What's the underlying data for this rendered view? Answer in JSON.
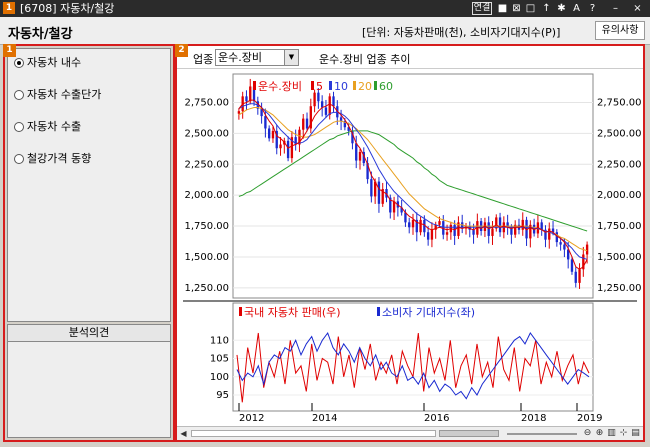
{
  "titlebar": {
    "badge": "1",
    "title": "[6708] 자동차/철강",
    "link_label": "연결",
    "icons": [
      "lock-icon",
      "close-box-icon",
      "restore-icon",
      "pin-icon",
      "settings-icon",
      "font-icon",
      "help-icon",
      "minimize-icon",
      "close-icon"
    ]
  },
  "header": {
    "title": "자동차/철강",
    "unit_text": "[단위: 자동차판매(천), 소비자기대지수(P)]",
    "notice_button": "유의사항"
  },
  "left_panel": {
    "badge": "1",
    "menu": [
      {
        "label": "자동차 내수",
        "selected": true
      },
      {
        "label": "자동차 수출단가",
        "selected": false
      },
      {
        "label": "자동차 수출",
        "selected": false
      },
      {
        "label": "철강가격 동향",
        "selected": false
      }
    ],
    "opinion_header": "분석의견"
  },
  "right_panel": {
    "badge": "2",
    "sector_label": "업종",
    "sector_value": "운수.장비",
    "chart_title": "운수.장비 업종 추이"
  },
  "chart_data": [
    {
      "type": "candlestick",
      "legend": [
        {
          "name": "운수.장비",
          "color": "#e00000"
        },
        {
          "name": "5",
          "color": "#e00000"
        },
        {
          "name": "10",
          "color": "#2a3ad8"
        },
        {
          "name": "20",
          "color": "#e8a020"
        },
        {
          "name": "60",
          "color": "#2e9e2e"
        }
      ],
      "ylim": [
        1200,
        2900
      ],
      "yticks": [
        1250,
        1500,
        1750,
        2000,
        2250,
        2500,
        2750
      ],
      "ytick_labels": [
        "1,250.00",
        "1,500.00",
        "1,750.00",
        "2,000.00",
        "2,250.00",
        "2,500.00",
        "2,750.00"
      ],
      "closes": [
        2680,
        2800,
        2760,
        2880,
        2760,
        2700,
        2640,
        2540,
        2460,
        2520,
        2380,
        2410,
        2440,
        2300,
        2470,
        2410,
        2530,
        2620,
        2540,
        2720,
        2830,
        2760,
        2710,
        2650,
        2800,
        2720,
        2630,
        2600,
        2550,
        2520,
        2420,
        2280,
        2350,
        2260,
        2130,
        1990,
        2110,
        1930,
        2050,
        1980,
        1860,
        1950,
        1900,
        1860,
        1780,
        1740,
        1800,
        1700,
        1800,
        1700,
        1640,
        1720,
        1760,
        1790,
        1680,
        1700,
        1760,
        1670,
        1780,
        1730,
        1750,
        1720,
        1680,
        1790,
        1710,
        1780,
        1670,
        1730,
        1820,
        1700,
        1780,
        1740,
        1680,
        1760,
        1720,
        1800,
        1650,
        1760,
        1690,
        1780,
        1720,
        1640,
        1730,
        1700,
        1620,
        1600,
        1560,
        1480,
        1380,
        1290,
        1400,
        1520,
        1600
      ],
      "ma": {
        "5": [
          2700,
          2740,
          2750,
          2770,
          2770,
          2740,
          2710,
          2650,
          2600,
          2560,
          2480,
          2460,
          2430,
          2380,
          2400,
          2410,
          2430,
          2470,
          2520,
          2580,
          2640,
          2680,
          2710,
          2720,
          2740,
          2720,
          2680,
          2650,
          2610,
          2560,
          2500,
          2420,
          2380,
          2320,
          2250,
          2160,
          2110,
          2050,
          2030,
          2010,
          1960,
          1950,
          1920,
          1900,
          1860,
          1830,
          1810,
          1780,
          1770,
          1760,
          1730,
          1720,
          1730,
          1740,
          1730,
          1720,
          1730,
          1720,
          1740,
          1730,
          1740,
          1730,
          1720,
          1740,
          1730,
          1750,
          1730,
          1740,
          1760,
          1740,
          1750,
          1740,
          1730,
          1740,
          1740,
          1750,
          1720,
          1740,
          1720,
          1740,
          1720,
          1700,
          1710,
          1700,
          1670,
          1650,
          1620,
          1570,
          1500,
          1420,
          1400,
          1420,
          1480
        ],
        "10": [
          2700,
          2720,
          2730,
          2740,
          2740,
          2730,
          2710,
          2680,
          2650,
          2610,
          2570,
          2530,
          2500,
          2470,
          2440,
          2420,
          2420,
          2430,
          2450,
          2490,
          2530,
          2570,
          2600,
          2630,
          2660,
          2670,
          2670,
          2660,
          2640,
          2610,
          2570,
          2530,
          2490,
          2440,
          2390,
          2330,
          2270,
          2210,
          2160,
          2110,
          2070,
          2030,
          2000,
          1970,
          1940,
          1910,
          1880,
          1850,
          1830,
          1810,
          1790,
          1770,
          1760,
          1750,
          1740,
          1740,
          1740,
          1740,
          1740,
          1740,
          1740,
          1740,
          1740,
          1740,
          1740,
          1740,
          1740,
          1740,
          1740,
          1740,
          1740,
          1740,
          1740,
          1740,
          1740,
          1740,
          1740,
          1740,
          1730,
          1730,
          1720,
          1710,
          1700,
          1690,
          1670,
          1650,
          1630,
          1600,
          1570,
          1530,
          1500,
          1490,
          1480
        ],
        "20": [
          2650,
          2670,
          2690,
          2700,
          2710,
          2710,
          2700,
          2690,
          2670,
          2650,
          2620,
          2590,
          2560,
          2530,
          2510,
          2490,
          2480,
          2470,
          2470,
          2480,
          2490,
          2510,
          2530,
          2550,
          2570,
          2590,
          2600,
          2600,
          2590,
          2580,
          2560,
          2540,
          2510,
          2480,
          2450,
          2410,
          2370,
          2330,
          2290,
          2250,
          2210,
          2170,
          2130,
          2090,
          2050,
          2010,
          1980,
          1950,
          1920,
          1890,
          1870,
          1850,
          1830,
          1810,
          1800,
          1790,
          1780,
          1770,
          1760,
          1760,
          1750,
          1750,
          1750,
          1750,
          1750,
          1750,
          1750,
          1750,
          1750,
          1750,
          1750,
          1750,
          1750,
          1750,
          1750,
          1750,
          1750,
          1740,
          1740,
          1730,
          1720,
          1710,
          1700,
          1690,
          1680,
          1660,
          1650,
          1630,
          1610,
          1590,
          1570,
          1560,
          1550
        ],
        "60": [
          1990,
          2000,
          2020,
          2030,
          2050,
          2070,
          2090,
          2110,
          2130,
          2150,
          2170,
          2190,
          2210,
          2230,
          2250,
          2270,
          2290,
          2310,
          2330,
          2350,
          2370,
          2390,
          2410,
          2430,
          2450,
          2460,
          2480,
          2490,
          2500,
          2510,
          2520,
          2520,
          2520,
          2520,
          2520,
          2510,
          2500,
          2490,
          2470,
          2450,
          2430,
          2410,
          2380,
          2360,
          2340,
          2320,
          2300,
          2270,
          2250,
          2220,
          2200,
          2170,
          2150,
          2120,
          2100,
          2080,
          2070,
          2060,
          2050,
          2040,
          2030,
          2020,
          2010,
          2000,
          1990,
          1980,
          1970,
          1960,
          1950,
          1940,
          1930,
          1920,
          1910,
          1900,
          1890,
          1880,
          1870,
          1860,
          1850,
          1840,
          1830,
          1820,
          1810,
          1800,
          1790,
          1780,
          1770,
          1760,
          1750,
          1740,
          1730,
          1720,
          1710
        ]
      }
    },
    {
      "type": "line",
      "series": [
        {
          "name": "국내 자동차 판매(우)",
          "color": "#e00000",
          "values": [
            106,
            93,
            108,
            101,
            112,
            97,
            104,
            100,
            107,
            98,
            110,
            101,
            103,
            96,
            109,
            99,
            105,
            104,
            98,
            111,
            100,
            106,
            97,
            108,
            102,
            109,
            99,
            104,
            101,
            106,
            98,
            107,
            103,
            100,
            112,
            96,
            108,
            101,
            105,
            99,
            110,
            97,
            103,
            106,
            98,
            109,
            100,
            104,
            97,
            111,
            102,
            99,
            108,
            96,
            105,
            103,
            110,
            98,
            104,
            100,
            107,
            99,
            103,
            106,
            98,
            104,
            101
          ]
        },
        {
          "name": "소비자 기대지수(좌)",
          "color": "#1a2ad0",
          "values": [
            102,
            99,
            101,
            100,
            103,
            98,
            104,
            106,
            105,
            108,
            107,
            110,
            106,
            109,
            111,
            107,
            110,
            112,
            108,
            106,
            109,
            107,
            104,
            108,
            105,
            103,
            106,
            102,
            104,
            101,
            100,
            103,
            99,
            100,
            98,
            101,
            97,
            99,
            96,
            98,
            97,
            95,
            96,
            94,
            97,
            95,
            98,
            100,
            102,
            104,
            106,
            108,
            110,
            111,
            109,
            112,
            110,
            108,
            106,
            104,
            102,
            100,
            98,
            100,
            102,
            101,
            100
          ]
        }
      ],
      "ylim": [
        92,
        115
      ],
      "yticks": [
        95,
        100,
        105,
        110
      ],
      "xlabels": [
        "2012",
        "2014",
        "2016",
        "2018",
        "2019"
      ]
    }
  ]
}
